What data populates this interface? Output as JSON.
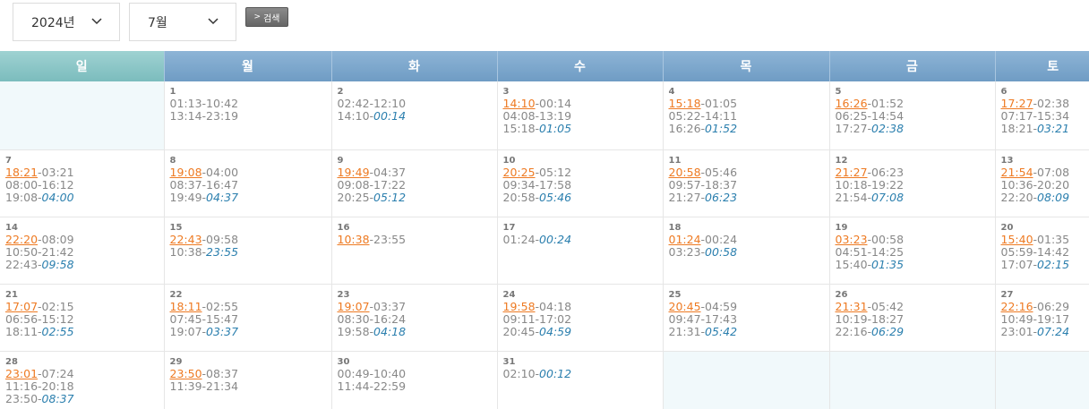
{
  "filters": {
    "year": "2024년",
    "month": "7월",
    "search_label": "검색",
    "search_arrow": ">"
  },
  "weekdays": [
    "일",
    "월",
    "화",
    "수",
    "목",
    "금",
    "토"
  ],
  "weeks": [
    [
      null,
      {
        "day": "1",
        "lines": [
          [
            {
              "t": "01:13-10:42"
            }
          ],
          [
            {
              "t": "13:14-23:19"
            }
          ]
        ]
      },
      {
        "day": "2",
        "lines": [
          [
            {
              "t": "02:42-12:10"
            }
          ],
          [
            {
              "t": "14:10-"
            },
            {
              "t": "00:14",
              "s": "it"
            }
          ]
        ]
      },
      {
        "day": "3",
        "lines": [
          [
            {
              "t": "14:10",
              "s": "hl"
            },
            {
              "t": "-00:14"
            }
          ],
          [
            {
              "t": "04:08-13:19"
            }
          ],
          [
            {
              "t": "15:18-"
            },
            {
              "t": "01:05",
              "s": "it"
            }
          ]
        ]
      },
      {
        "day": "4",
        "lines": [
          [
            {
              "t": "15:18",
              "s": "hl"
            },
            {
              "t": "-01:05"
            }
          ],
          [
            {
              "t": "05:22-14:11"
            }
          ],
          [
            {
              "t": "16:26-"
            },
            {
              "t": "01:52",
              "s": "it"
            }
          ]
        ]
      },
      {
        "day": "5",
        "lines": [
          [
            {
              "t": "16:26",
              "s": "hl"
            },
            {
              "t": "-01:52"
            }
          ],
          [
            {
              "t": "06:25-14:54"
            }
          ],
          [
            {
              "t": "17:27-"
            },
            {
              "t": "02:38",
              "s": "it"
            }
          ]
        ]
      },
      {
        "day": "6",
        "lines": [
          [
            {
              "t": "17:27",
              "s": "hl"
            },
            {
              "t": "-02:38"
            }
          ],
          [
            {
              "t": "07:17-15:34"
            }
          ],
          [
            {
              "t": "18:21-"
            },
            {
              "t": "03:21",
              "s": "it"
            }
          ]
        ]
      }
    ],
    [
      {
        "day": "7",
        "lines": [
          [
            {
              "t": "18:21",
              "s": "hl"
            },
            {
              "t": "-03:21"
            }
          ],
          [
            {
              "t": "08:00-16:12"
            }
          ],
          [
            {
              "t": "19:08-"
            },
            {
              "t": "04:00",
              "s": "it"
            }
          ]
        ]
      },
      {
        "day": "8",
        "lines": [
          [
            {
              "t": "19:08",
              "s": "hl"
            },
            {
              "t": "-04:00"
            }
          ],
          [
            {
              "t": "08:37-16:47"
            }
          ],
          [
            {
              "t": "19:49-"
            },
            {
              "t": "04:37",
              "s": "it"
            }
          ]
        ]
      },
      {
        "day": "9",
        "lines": [
          [
            {
              "t": "19:49",
              "s": "hl"
            },
            {
              "t": "-04:37"
            }
          ],
          [
            {
              "t": "09:08-17:22"
            }
          ],
          [
            {
              "t": "20:25-"
            },
            {
              "t": "05:12",
              "s": "it"
            }
          ]
        ]
      },
      {
        "day": "10",
        "lines": [
          [
            {
              "t": "20:25",
              "s": "hl"
            },
            {
              "t": "-05:12"
            }
          ],
          [
            {
              "t": "09:34-17:58"
            }
          ],
          [
            {
              "t": "20:58-"
            },
            {
              "t": "05:46",
              "s": "it"
            }
          ]
        ]
      },
      {
        "day": "11",
        "lines": [
          [
            {
              "t": "20:58",
              "s": "hl"
            },
            {
              "t": "-05:46"
            }
          ],
          [
            {
              "t": "09:57-18:37"
            }
          ],
          [
            {
              "t": "21:27-"
            },
            {
              "t": "06:23",
              "s": "it"
            }
          ]
        ]
      },
      {
        "day": "12",
        "lines": [
          [
            {
              "t": "21:27",
              "s": "hl"
            },
            {
              "t": "-06:23"
            }
          ],
          [
            {
              "t": "10:18-19:22"
            }
          ],
          [
            {
              "t": "21:54-"
            },
            {
              "t": "07:08",
              "s": "it"
            }
          ]
        ]
      },
      {
        "day": "13",
        "lines": [
          [
            {
              "t": "21:54",
              "s": "hl"
            },
            {
              "t": "-07:08"
            }
          ],
          [
            {
              "t": "10:36-20:20"
            }
          ],
          [
            {
              "t": "22:20-"
            },
            {
              "t": "08:09",
              "s": "it"
            }
          ]
        ]
      }
    ],
    [
      {
        "day": "14",
        "lines": [
          [
            {
              "t": "22:20",
              "s": "hl"
            },
            {
              "t": "-08:09"
            }
          ],
          [
            {
              "t": "10:50-21:42"
            }
          ],
          [
            {
              "t": "22:43-"
            },
            {
              "t": "09:58",
              "s": "it"
            }
          ]
        ]
      },
      {
        "day": "15",
        "lines": [
          [
            {
              "t": "22:43",
              "s": "hl"
            },
            {
              "t": "-09:58"
            }
          ],
          [
            {
              "t": "10:38-"
            },
            {
              "t": "23:55",
              "s": "it"
            }
          ]
        ]
      },
      {
        "day": "16",
        "lines": [
          [
            {
              "t": "10:38",
              "s": "hl"
            },
            {
              "t": "-23:55"
            }
          ]
        ]
      },
      {
        "day": "17",
        "lines": [
          [
            {
              "t": "01:24-"
            },
            {
              "t": "00:24",
              "s": "it"
            }
          ]
        ]
      },
      {
        "day": "18",
        "lines": [
          [
            {
              "t": "01:24",
              "s": "hl"
            },
            {
              "t": "-00:24"
            }
          ],
          [
            {
              "t": "03:23-"
            },
            {
              "t": "00:58",
              "s": "it"
            }
          ]
        ]
      },
      {
        "day": "19",
        "lines": [
          [
            {
              "t": "03:23",
              "s": "hl"
            },
            {
              "t": "-00:58"
            }
          ],
          [
            {
              "t": "04:51-14:25"
            }
          ],
          [
            {
              "t": "15:40-"
            },
            {
              "t": "01:35",
              "s": "it"
            }
          ]
        ]
      },
      {
        "day": "20",
        "lines": [
          [
            {
              "t": "15:40",
              "s": "hl"
            },
            {
              "t": "-01:35"
            }
          ],
          [
            {
              "t": "05:59-14:42"
            }
          ],
          [
            {
              "t": "17:07-"
            },
            {
              "t": "02:15",
              "s": "it"
            }
          ]
        ]
      }
    ],
    [
      {
        "day": "21",
        "lines": [
          [
            {
              "t": "17:07",
              "s": "hl"
            },
            {
              "t": "-02:15"
            }
          ],
          [
            {
              "t": "06:56-15:12"
            }
          ],
          [
            {
              "t": "18:11-"
            },
            {
              "t": "02:55",
              "s": "it"
            }
          ]
        ]
      },
      {
        "day": "22",
        "lines": [
          [
            {
              "t": "18:11",
              "s": "hl"
            },
            {
              "t": "-02:55"
            }
          ],
          [
            {
              "t": "07:45-15:47"
            }
          ],
          [
            {
              "t": "19:07-"
            },
            {
              "t": "03:37",
              "s": "it"
            }
          ]
        ]
      },
      {
        "day": "23",
        "lines": [
          [
            {
              "t": "19:07",
              "s": "hl"
            },
            {
              "t": "-03:37"
            }
          ],
          [
            {
              "t": "08:30-16:24"
            }
          ],
          [
            {
              "t": "19:58-"
            },
            {
              "t": "04:18",
              "s": "it"
            }
          ]
        ]
      },
      {
        "day": "24",
        "lines": [
          [
            {
              "t": "19:58",
              "s": "hl"
            },
            {
              "t": "-04:18"
            }
          ],
          [
            {
              "t": "09:11-17:02"
            }
          ],
          [
            {
              "t": "20:45-"
            },
            {
              "t": "04:59",
              "s": "it"
            }
          ]
        ]
      },
      {
        "day": "25",
        "lines": [
          [
            {
              "t": "20:45",
              "s": "hl"
            },
            {
              "t": "-04:59"
            }
          ],
          [
            {
              "t": "09:47-17:43"
            }
          ],
          [
            {
              "t": "21:31-"
            },
            {
              "t": "05:42",
              "s": "it"
            }
          ]
        ]
      },
      {
        "day": "26",
        "lines": [
          [
            {
              "t": "21:31",
              "s": "hl"
            },
            {
              "t": "-05:42"
            }
          ],
          [
            {
              "t": "10:19-18:27"
            }
          ],
          [
            {
              "t": "22:16-"
            },
            {
              "t": "06:29",
              "s": "it"
            }
          ]
        ]
      },
      {
        "day": "27",
        "lines": [
          [
            {
              "t": "22:16",
              "s": "hl"
            },
            {
              "t": "-06:29"
            }
          ],
          [
            {
              "t": "10:49-19:17"
            }
          ],
          [
            {
              "t": "23:01-"
            },
            {
              "t": "07:24",
              "s": "it"
            }
          ]
        ]
      }
    ],
    [
      {
        "day": "28",
        "lines": [
          [
            {
              "t": "23:01",
              "s": "hl"
            },
            {
              "t": "-07:24"
            }
          ],
          [
            {
              "t": "11:16-20:18"
            }
          ],
          [
            {
              "t": "23:50-"
            },
            {
              "t": "08:37",
              "s": "it"
            }
          ]
        ]
      },
      {
        "day": "29",
        "lines": [
          [
            {
              "t": "23:50",
              "s": "hl"
            },
            {
              "t": "-08:37"
            }
          ],
          [
            {
              "t": "11:39-21:34"
            }
          ]
        ]
      },
      {
        "day": "30",
        "lines": [
          [
            {
              "t": "00:49-10:40"
            }
          ],
          [
            {
              "t": "11:44-22:59"
            }
          ]
        ]
      },
      {
        "day": "31",
        "lines": [
          [
            {
              "t": "02:10-"
            },
            {
              "t": "00:12",
              "s": "it"
            }
          ]
        ]
      },
      null,
      null,
      null
    ]
  ]
}
